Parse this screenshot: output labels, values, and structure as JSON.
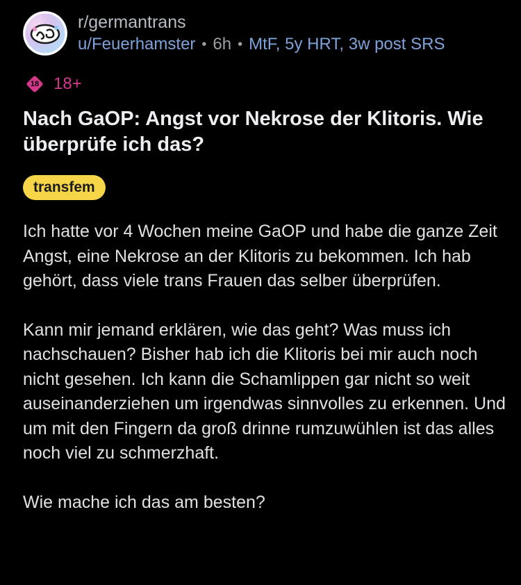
{
  "post": {
    "subreddit": "r/germantrans",
    "username": "u/Feuerhamster",
    "separator": "•",
    "time_ago": "6h",
    "user_flair": "MtF, 5y HRT, 3w post SRS",
    "nsfw_badge_number": "18",
    "nsfw_label": "18+",
    "title": "Nach GaOP: Angst vor Nekrose der Klitoris. Wie überprüfe ich das?",
    "post_flair": "transfem",
    "paragraphs": [
      "Ich hatte vor 4 Wochen meine GaOP und habe die ganze Zeit Angst, eine Nekrose an der Klitoris zu bekommen. Ich hab gehört, dass viele trans Frauen das selber überprüfen.",
      "Kann mir jemand erklären, wie das geht? Was muss ich nachschauen? Bisher hab ich die Klitoris bei mir auch noch nicht gesehen. Ich kann die Schamlippen gar nicht so weit auseinanderziehen um irgendwas sinnvolles zu erkennen. Und um mit den Fingern da groß drinne rumzuwühlen ist das alles noch viel zu schmerzhaft.",
      "Wie mache ich das am besten?"
    ]
  },
  "icons": {
    "avatar": "subreddit-avatar-icon",
    "nsfw": "nsfw-18-icon"
  },
  "colors": {
    "background": "#000000",
    "link_blue": "#7ea3da",
    "nsfw_pink": "#d4388b",
    "flair_yellow": "#f7d548"
  }
}
